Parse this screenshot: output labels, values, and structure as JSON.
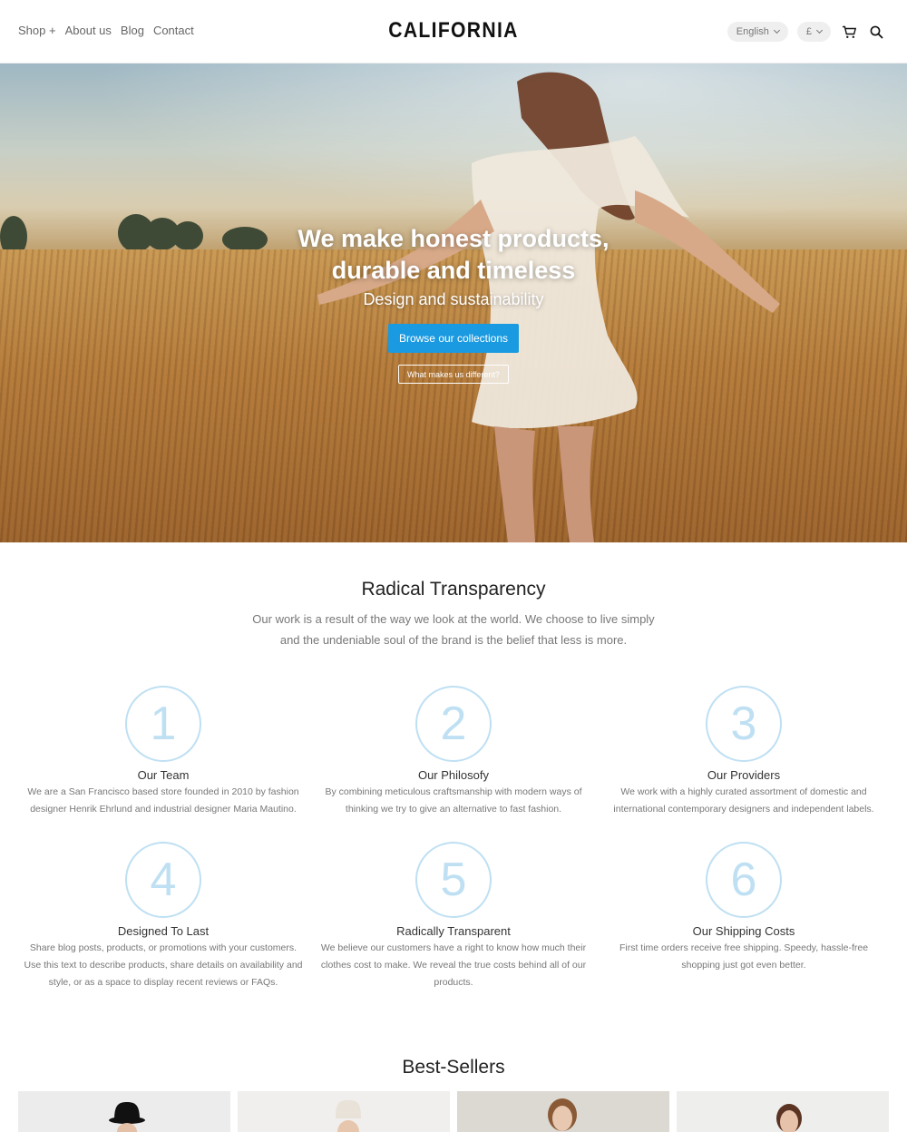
{
  "header": {
    "nav": [
      "Shop +",
      "About us",
      "Blog",
      "Contact"
    ],
    "logo": "CALIFORNIA",
    "language": "English",
    "currency": "£",
    "cart_icon": "cart-icon",
    "search_icon": "search-icon"
  },
  "hero": {
    "title_line1": "We make honest products,",
    "title_line2": "durable and timeless",
    "subtitle": "Design and sustainability",
    "primary_cta": "Browse our collections",
    "secondary_cta": "What makes us different?"
  },
  "transparency": {
    "title": "Radical Transparency",
    "intro": "Our work is a result of the way we look at the world. We choose to live simply and the undeniable soul of the brand is the belief that less is more.",
    "features": [
      {
        "number": "1",
        "title": "Our Team",
        "text": "We are a San Francisco based store founded in 2010 by fashion designer Henrik Ehrlund and industrial designer Maria Mautino."
      },
      {
        "number": "2",
        "title": "Our Philosofy",
        "text": "By combining meticulous craftsmanship with modern ways of thinking we try to give an alternative to fast fashion."
      },
      {
        "number": "3",
        "title": "Our Providers",
        "text": "We work with a highly curated assortment of domestic and international contemporary designers and independent labels."
      },
      {
        "number": "4",
        "title": "Designed To Last",
        "text": "Share blog posts, products, or promotions with your customers. Use this text to describe products, share details on availability and style, or as a space to display recent reviews or FAQs."
      },
      {
        "number": "5",
        "title": "Radically Transparent",
        "text": "We believe our customers have a right to know how much their clothes cost to make. We reveal the true costs behind all of our products."
      },
      {
        "number": "6",
        "title": "Our Shipping Costs",
        "text": "First time orders receive free shipping. Speedy, hassle-free shopping just got even better."
      }
    ]
  },
  "best_sellers": {
    "title": "Best-Sellers"
  }
}
